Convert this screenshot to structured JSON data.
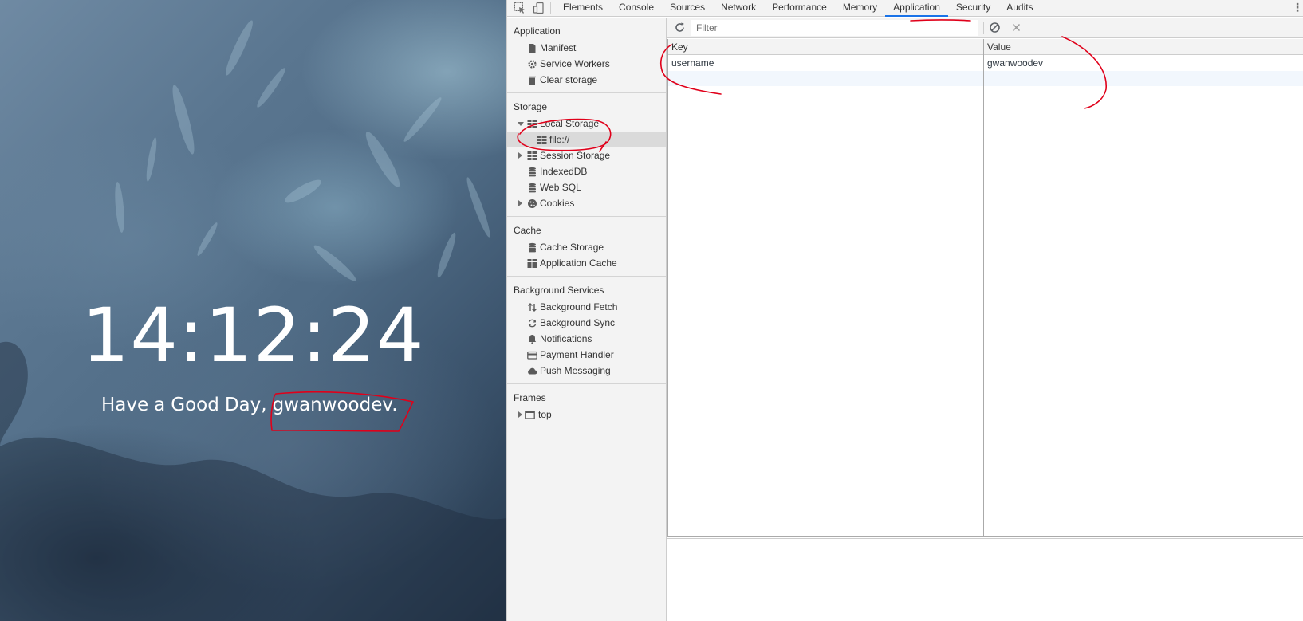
{
  "page_preview": {
    "clock_text": "14:12:24",
    "greeting_prefix": "Have",
    "greeting_word2": "a",
    "greeting_word3": "Good",
    "greeting_word4": "Day,",
    "greeting_name": "gwanwoodev."
  },
  "devtools": {
    "tabs": [
      {
        "label": "Elements"
      },
      {
        "label": "Console"
      },
      {
        "label": "Sources"
      },
      {
        "label": "Network"
      },
      {
        "label": "Performance"
      },
      {
        "label": "Memory"
      },
      {
        "label": "Application",
        "selected": true
      },
      {
        "label": "Security"
      },
      {
        "label": "Audits"
      }
    ],
    "toolbar_icons": {
      "inspect": "inspect-element-icon",
      "device": "device-toolbar-icon",
      "menu": "more-options-icon"
    },
    "sidebar": {
      "application": {
        "title": "Application",
        "items": [
          {
            "label": "Manifest",
            "icon": "file-icon"
          },
          {
            "label": "Service Workers",
            "icon": "gear-icon"
          },
          {
            "label": "Clear storage",
            "icon": "trash-icon"
          }
        ]
      },
      "storage": {
        "title": "Storage",
        "items": [
          {
            "label": "Local Storage",
            "icon": "grid-icon",
            "expanded": true
          },
          {
            "label": "file://",
            "icon": "grid-icon",
            "selected": true
          },
          {
            "label": "Session Storage",
            "icon": "grid-icon",
            "expanded": false
          },
          {
            "label": "IndexedDB",
            "icon": "database-icon"
          },
          {
            "label": "Web SQL",
            "icon": "database-icon"
          },
          {
            "label": "Cookies",
            "icon": "cookie-icon",
            "expanded": false
          }
        ]
      },
      "cache": {
        "title": "Cache",
        "items": [
          {
            "label": "Cache Storage",
            "icon": "database-icon"
          },
          {
            "label": "Application Cache",
            "icon": "grid-icon"
          }
        ]
      },
      "background": {
        "title": "Background Services",
        "items": [
          {
            "label": "Background Fetch",
            "icon": "arrows-updown-icon"
          },
          {
            "label": "Background Sync",
            "icon": "sync-icon"
          },
          {
            "label": "Notifications",
            "icon": "bell-icon"
          },
          {
            "label": "Payment Handler",
            "icon": "card-icon"
          },
          {
            "label": "Push Messaging",
            "icon": "cloud-icon"
          }
        ]
      },
      "frames": {
        "title": "Frames",
        "items": [
          {
            "label": "top",
            "icon": "frame-icon",
            "expanded": false
          }
        ]
      }
    },
    "filter": {
      "placeholder": "Filter",
      "value": ""
    },
    "table": {
      "columns": [
        "Key",
        "Value"
      ],
      "rows": [
        {
          "key": "username",
          "value": "gwanwoodev"
        }
      ]
    },
    "accent_color": "#1a73e8",
    "annotation_color": "#e0001a"
  }
}
